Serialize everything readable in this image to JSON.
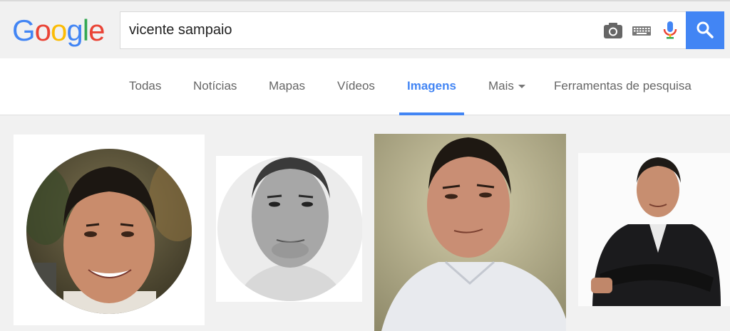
{
  "logo": {
    "letters": [
      "G",
      "o",
      "o",
      "g",
      "l",
      "e"
    ],
    "colors": [
      "#4285f4",
      "#ea4335",
      "#fbbc05",
      "#4285f4",
      "#34a853",
      "#ea4335"
    ]
  },
  "search": {
    "query": "vicente sampaio",
    "icons": [
      "camera-icon",
      "keyboard-icon",
      "microphone-icon",
      "search-icon"
    ]
  },
  "tabs": [
    {
      "label": "Todas",
      "active": false
    },
    {
      "label": "Notícias",
      "active": false
    },
    {
      "label": "Mapas",
      "active": false
    },
    {
      "label": "Vídeos",
      "active": false
    },
    {
      "label": "Imagens",
      "active": true
    },
    {
      "label": "Mais",
      "active": false
    },
    {
      "label": "Ferramentas de pesquisa",
      "active": false
    }
  ],
  "colors": {
    "accent": "#4285f4",
    "tab_text": "#666666",
    "background": "#f1f1f1"
  },
  "results": [
    {
      "description": "circular portrait, young man smiling, green foliage background"
    },
    {
      "description": "circular black and white portrait of man"
    },
    {
      "description": "portrait of man in white shirt, beige background"
    },
    {
      "description": "man in black suit with arms crossed, white background"
    }
  ]
}
